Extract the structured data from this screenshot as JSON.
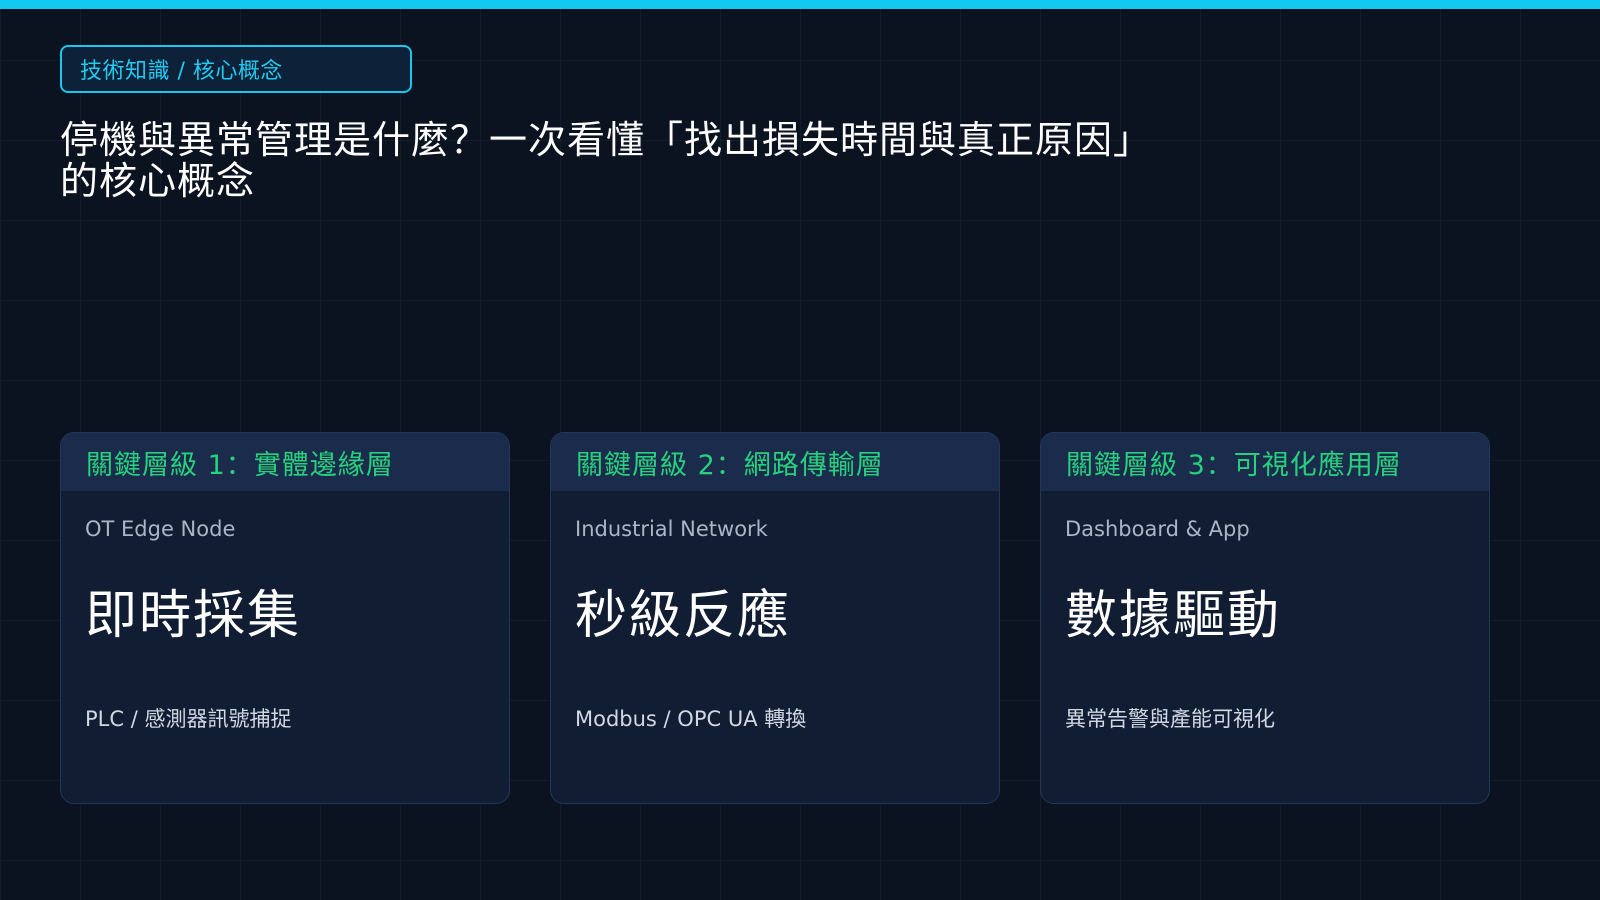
{
  "colors": {
    "accent_cyan": "#10c8f0",
    "accent_green": "#27d07d",
    "background": "#0b1220",
    "card_background": "#111d33",
    "card_header_background": "#1a2b4c"
  },
  "breadcrumb": "技術知識 / 核心概念",
  "title": {
    "line1": "停機與異常管理是什麼？一次看懂「找出損失時間與真正原因」",
    "line2": "的核心概念"
  },
  "cards": [
    {
      "header": "關鍵層級 1：實體邊緣層",
      "subtitle": "OT Edge Node",
      "headline": "即時採集",
      "description": "PLC / 感測器訊號捕捉"
    },
    {
      "header": "關鍵層級 2：網路傳輸層",
      "subtitle": "Industrial Network",
      "headline": "秒級反應",
      "description": "Modbus / OPC UA 轉換"
    },
    {
      "header": "關鍵層級 3：可視化應用層",
      "subtitle": "Dashboard & App",
      "headline": "數據驅動",
      "description": "異常告警與產能可視化"
    }
  ]
}
